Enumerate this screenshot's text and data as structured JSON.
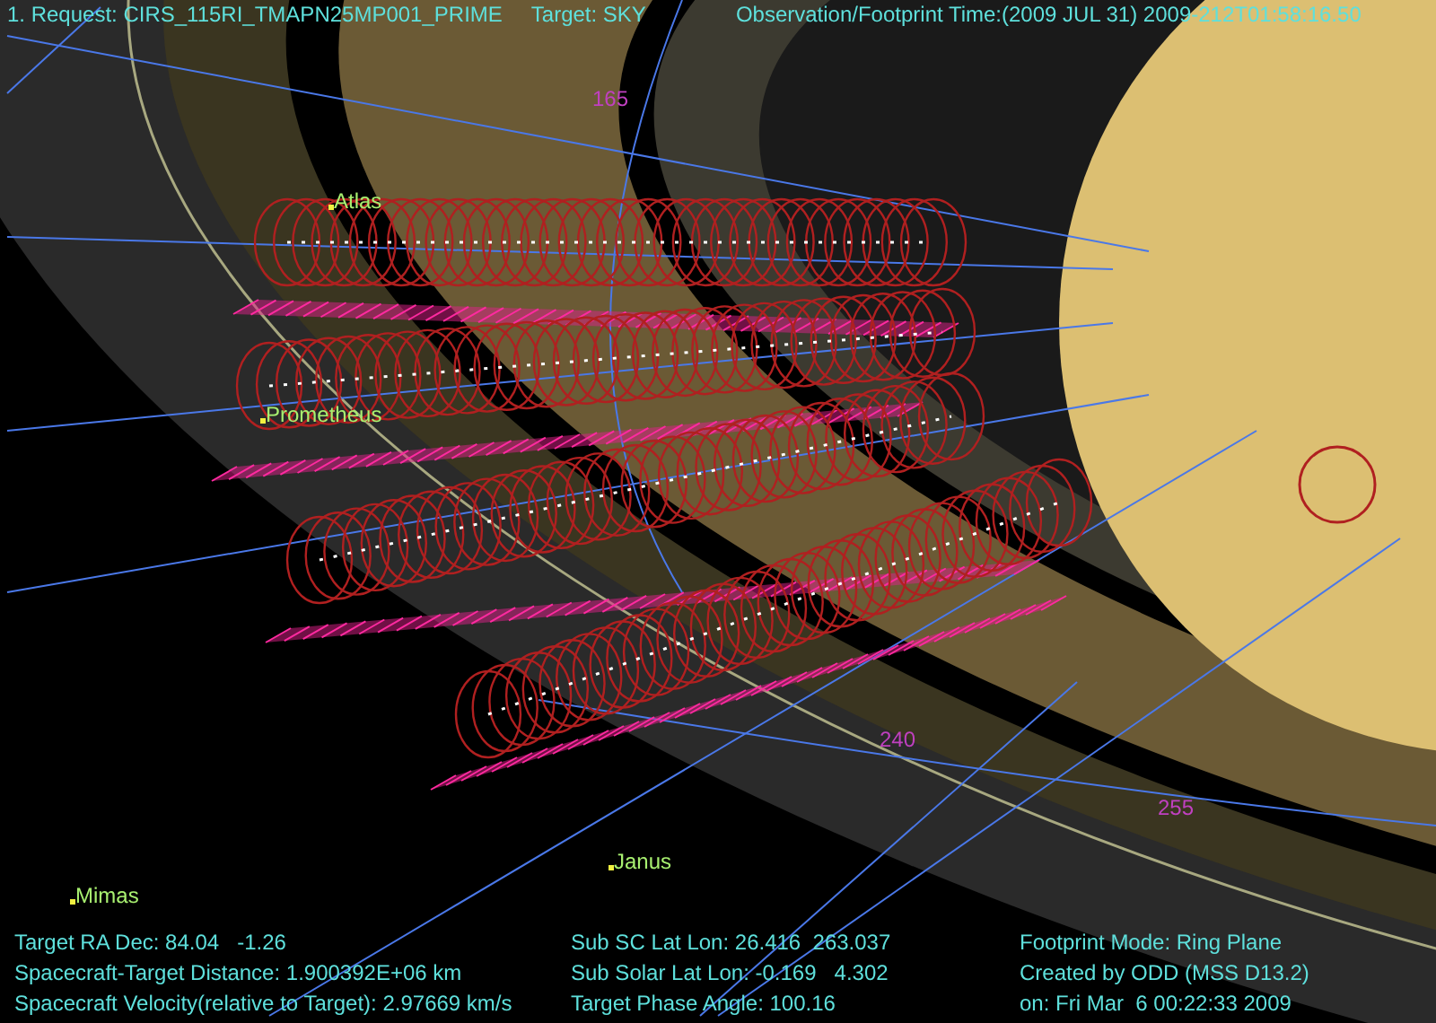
{
  "header": {
    "request": "1. Request: CIRS_115RI_TMAPN25MP001_PRIME",
    "target": "Target: SKY",
    "time": "Observation/Footprint Time:(2009 JUL 31) 2009-212T01:58:16.50"
  },
  "moons": [
    {
      "name": "Atlas"
    },
    {
      "name": "Prometheus"
    },
    {
      "name": "Janus"
    },
    {
      "name": "Mimas"
    }
  ],
  "longitude_labels": [
    "165",
    "240",
    "255"
  ],
  "info_columns": [
    [
      "Target RA Dec: 84.04   -1.26",
      "Spacecraft-Target Distance: 1.900392E+06 km",
      "Spacecraft Velocity(relative to Target): 2.97669 km/s"
    ],
    [
      "Sub SC Lat Lon: 26.416  263.037",
      "Sub Solar Lat Lon: -0.169   4.302",
      "Target Phase Angle: 100.16"
    ],
    [
      "Footprint Mode: Ring Plane",
      "Created by ODD (MSS D13.2)",
      "on: Fri Mar  6 00:22:33 2009"
    ]
  ]
}
